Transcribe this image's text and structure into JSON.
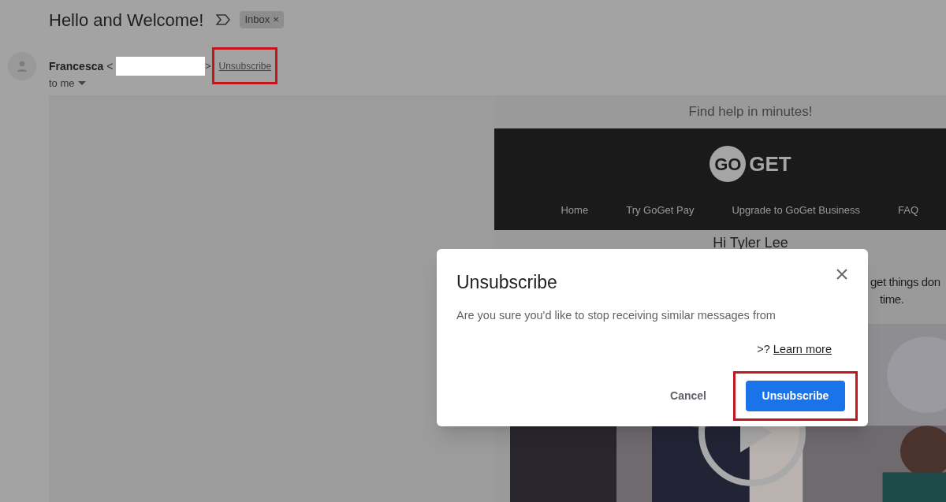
{
  "email": {
    "subject": "Hello and Welcome!",
    "label_chip": {
      "text": "Inbox",
      "remove": "×"
    },
    "sender": {
      "name": "Francesca",
      "open_bracket": "<",
      "close_bracket": ">",
      "unsubscribe_link": {
        "text": "Unsubscribe",
        "highlighted": true
      },
      "recipient": "to me"
    }
  },
  "message": {
    "preheader": "Find help in minutes!",
    "logo": {
      "left": "GO",
      "right": "GET"
    },
    "nav": [
      "Home",
      "Try GoGet Pay",
      "Upgrade to GoGet Business",
      "FAQ"
    ],
    "greeting": "Hi Tyler Lee",
    "body_lines": [
      "get things don",
      "time."
    ]
  },
  "dialog": {
    "title": "Unsubscribe",
    "text": "Are you sure you'd like to stop receiving similar messages from",
    "text_end": ">?",
    "link": "Learn more",
    "buttons": [
      {
        "label": "Cancel",
        "kind": "text",
        "highlighted": false
      },
      {
        "label": "Unsubscribe",
        "kind": "primary",
        "highlighted": true
      }
    ]
  }
}
